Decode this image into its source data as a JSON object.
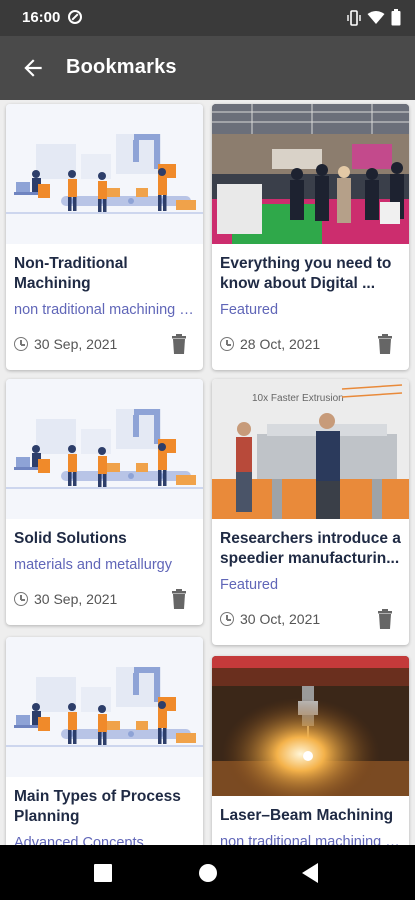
{
  "status": {
    "time": "16:00"
  },
  "appbar": {
    "title": "Bookmarks"
  },
  "cards": [
    {
      "title": "Non-Traditional Machining",
      "tag": "non traditional machining p...",
      "date": "30 Sep, 2021",
      "image": "factory-illustration"
    },
    {
      "title": "Everything you need to know about Digital ...",
      "tag": "Featured",
      "date": "28 Oct, 2021",
      "image": "exhibition-photo"
    },
    {
      "title": "Solid Solutions",
      "tag": "materials and metallurgy",
      "date": "30 Sep, 2021",
      "image": "factory-illustration"
    },
    {
      "title": "Researchers introduce a speedier manufacturin...",
      "tag": "Featured",
      "date": "30 Oct, 2021",
      "image": "extrusion-machine-photo"
    },
    {
      "title": "Main Types of Process Planning",
      "tag": "Advanced Concepts",
      "date": "",
      "image": "factory-illustration"
    },
    {
      "title": "Laser–Beam Machining",
      "tag": "non traditional machining p...",
      "date": "",
      "image": "laser-cutting-photo"
    }
  ],
  "colors": {
    "statusbar": "#3a3a3a",
    "appbar": "#4a4a4a",
    "tag": "#6066b8",
    "title": "#1f2a44"
  }
}
